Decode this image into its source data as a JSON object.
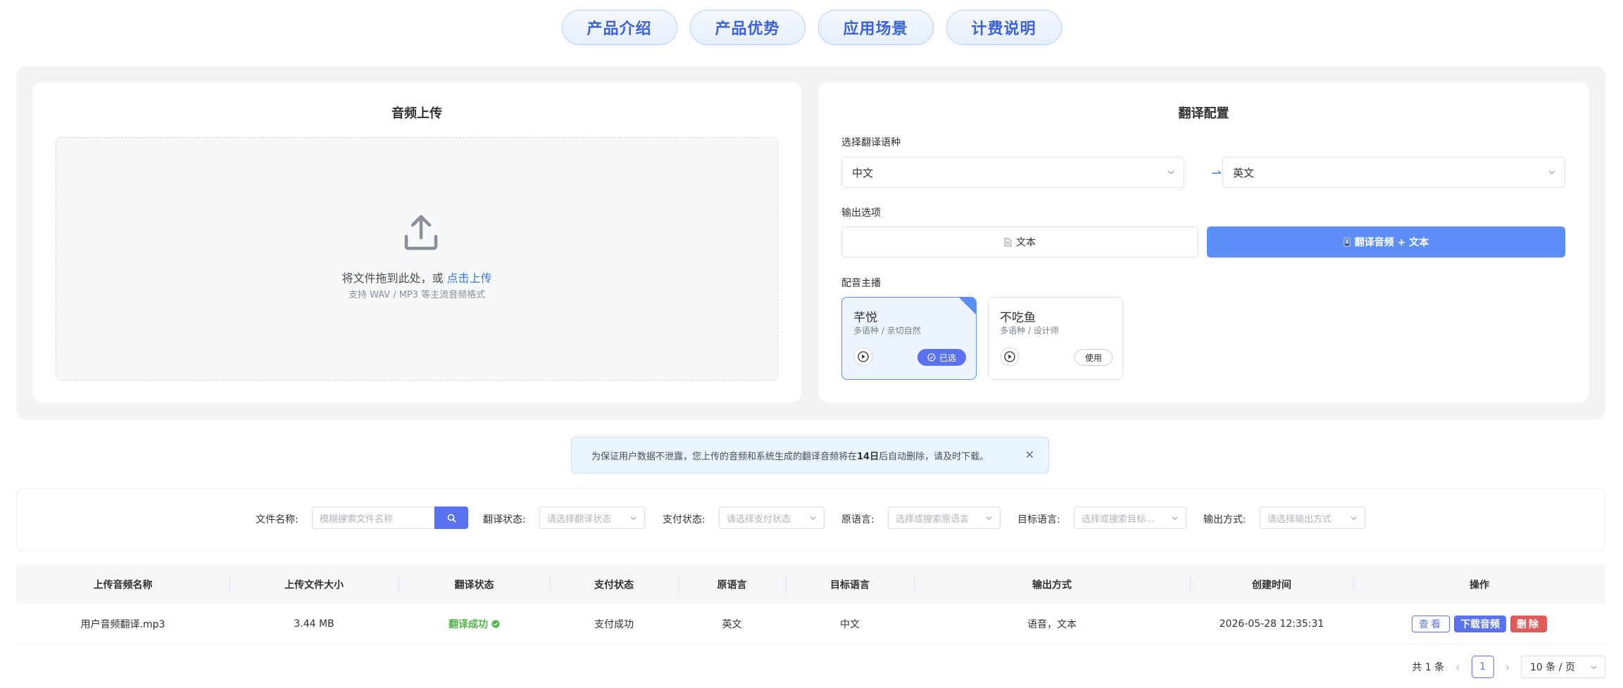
{
  "tabs": [
    "产品介绍",
    "产品优势",
    "应用场景",
    "计费说明"
  ],
  "upload": {
    "title": "音频上传",
    "drop_text": "将文件拖到此处，或",
    "click_link": "点击上传",
    "hint": "支持 WAV / MP3 等主流音频格式"
  },
  "config": {
    "title": "翻译配置",
    "lang_label": "选择翻译语种",
    "source_lang": "中文",
    "target_lang": "英文",
    "output_label": "输出选项",
    "output_text": "文本",
    "output_audio_text": "翻译音频 + 文本",
    "voice_label": "配音主播",
    "voices": [
      {
        "name": "芊悦",
        "desc": "多语种 / 亲切自然",
        "badge": "已选",
        "selected": true
      },
      {
        "name": "不吃鱼",
        "desc": "多语种 / 设计师",
        "badge": "使用",
        "selected": false
      }
    ]
  },
  "notice": {
    "prefix": "为保证用户数据不泄露，您上传的音频和系统生成的翻译音频将在",
    "days": "14日",
    "suffix": "后自动删除，请及时下载。"
  },
  "filters": {
    "file_name_label": "文件名称:",
    "file_name_placeholder": "模糊搜索文件名称",
    "translate_status_label": "翻译状态:",
    "translate_status_placeholder": "请选择翻译状态",
    "pay_status_label": "支付状态:",
    "pay_status_placeholder": "请选择支付状态",
    "source_lang_label": "原语言:",
    "source_lang_placeholder": "选择或搜索原语言",
    "target_lang_label": "目标语言:",
    "target_lang_placeholder": "选择或搜索目标...",
    "output_mode_label": "输出方式:",
    "output_mode_placeholder": "请选择输出方式"
  },
  "table": {
    "headers": [
      "上传音频名称",
      "上传文件大小",
      "翻译状态",
      "支付状态",
      "原语言",
      "目标语言",
      "输出方式",
      "创建时间",
      "操作"
    ],
    "rows": [
      {
        "name": "用户音频翻译.mp3",
        "size": "3.44 MB",
        "translate_status": "翻译成功",
        "pay_status": "支付成功",
        "source": "英文",
        "target": "中文",
        "output": "语音，文本",
        "created": "2026-05-28 12:35:31",
        "actions": [
          "查看",
          "下载音频",
          "删除"
        ]
      }
    ]
  },
  "pagination": {
    "total": "共 1 条",
    "current": "1",
    "page_size": "10 条 / 页"
  },
  "colors": {
    "accent": "#5b72f0",
    "primary_blue": "#5b8ef7",
    "success": "#52b54b",
    "danger": "#e05a5a"
  }
}
